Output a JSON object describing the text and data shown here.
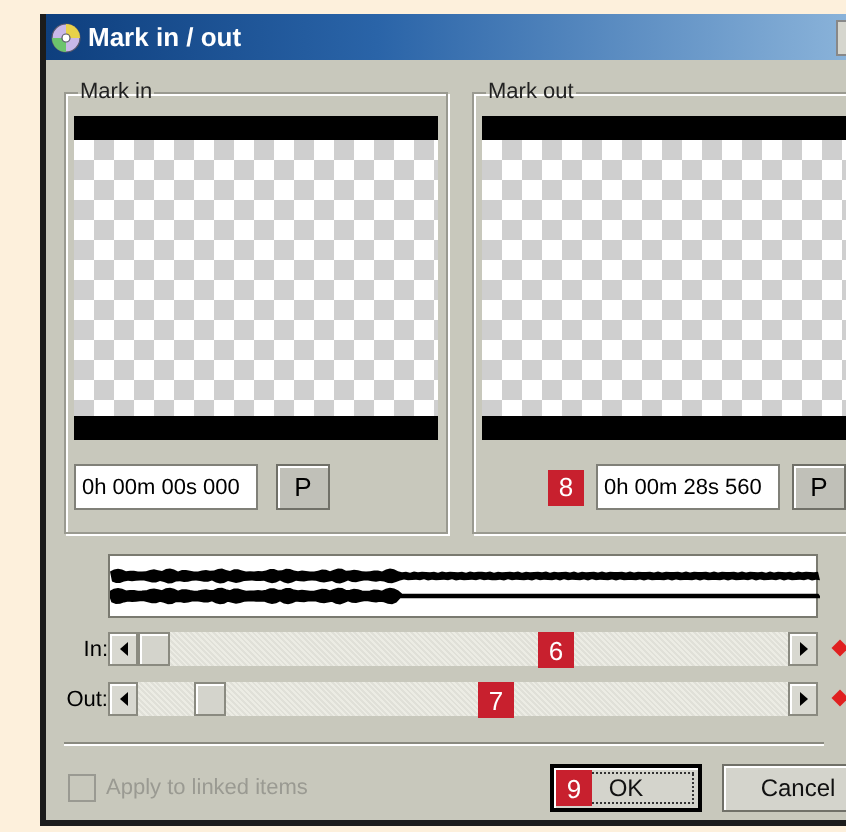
{
  "window": {
    "title": "Mark in / out"
  },
  "panels": [
    {
      "label": "Mark in",
      "timecode": "0h 00m 00s 000",
      "button": "P"
    },
    {
      "label": "Mark out",
      "callout": "8",
      "timecode": "0h 00m 28s 560",
      "button": "P"
    }
  ],
  "sliders": [
    {
      "label": "In:",
      "level": 0.0,
      "callout": "6"
    },
    {
      "label": "Out:",
      "level": 0.09,
      "callout": "7"
    }
  ],
  "apply_linked": {
    "label": "Apply to linked items",
    "checked": false,
    "disabled": true
  },
  "buttons": [
    {
      "label": "OK",
      "focused": true,
      "callout": "9"
    },
    {
      "label": "Cancel",
      "focused": false
    }
  ]
}
